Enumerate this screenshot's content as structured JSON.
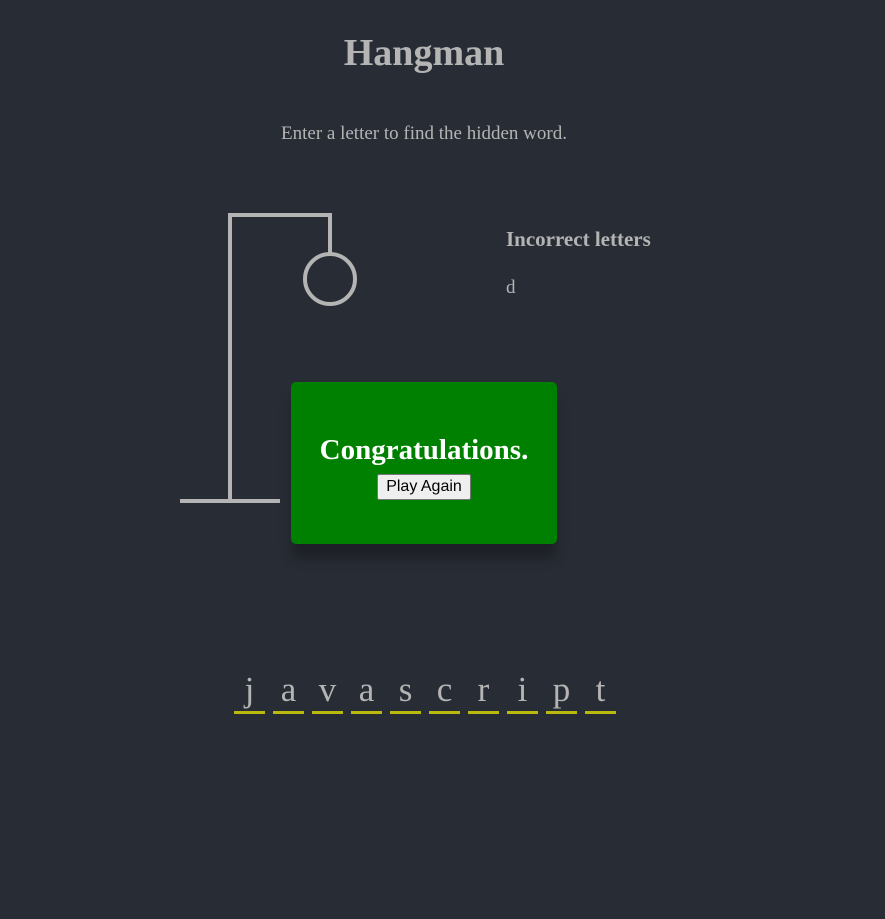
{
  "header": {
    "title": "Hangman",
    "subtitle": "Enter a letter to find the hidden word."
  },
  "wrong_letters": {
    "title": "Incorrect letters",
    "letters": "d"
  },
  "popup": {
    "message": "Congratulations.",
    "play_again_label": "Play Again"
  },
  "word": {
    "letters": [
      "j",
      "a",
      "v",
      "a",
      "s",
      "c",
      "r",
      "i",
      "p",
      "t"
    ]
  },
  "colors": {
    "background": "#282d35",
    "popup_background": "#008000",
    "letter_underline": "#b9b90e",
    "figure_stroke": "#b4b4b4"
  }
}
